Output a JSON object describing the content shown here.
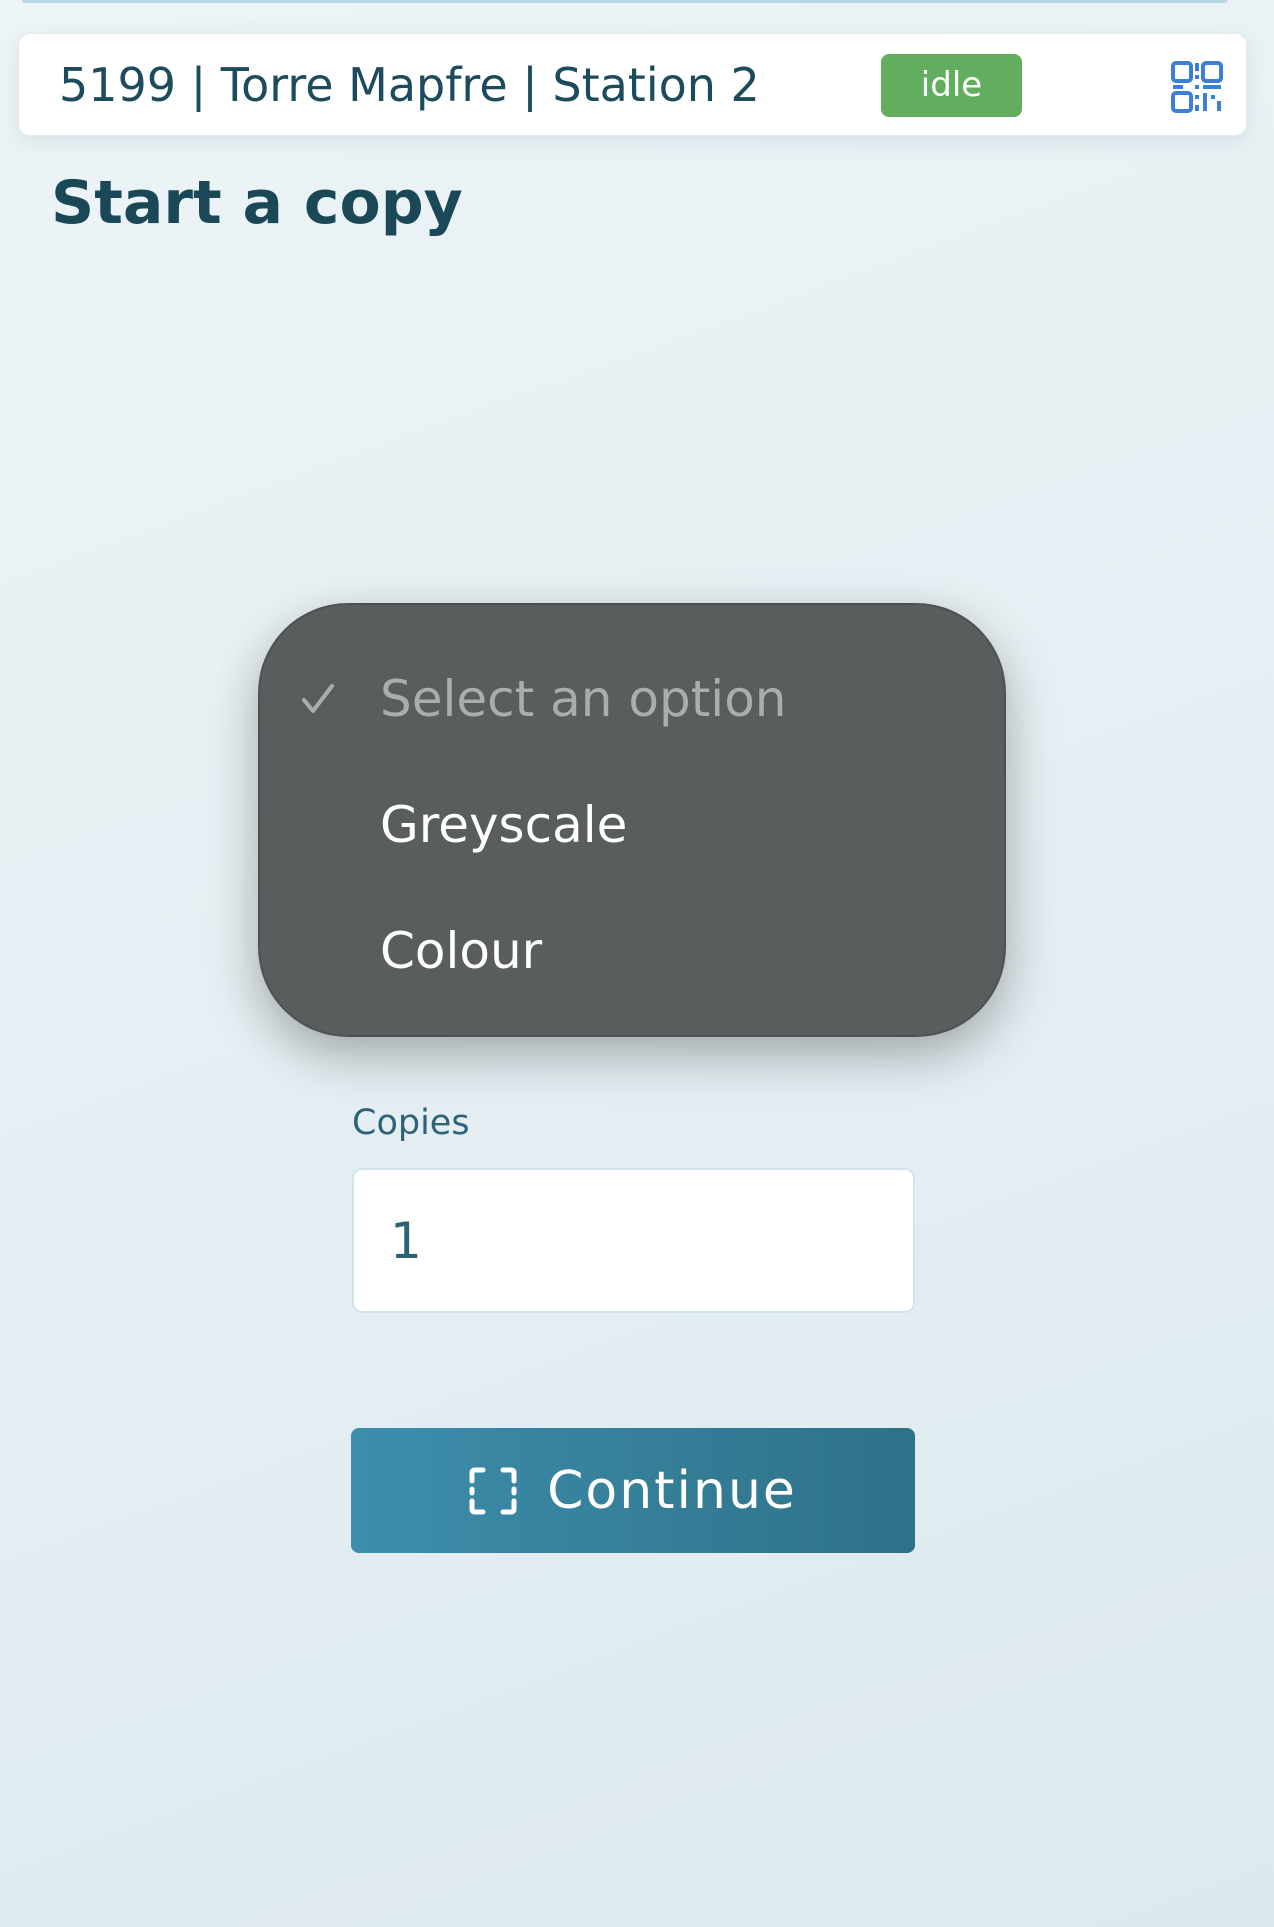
{
  "station": {
    "name": "5199 | Torre Mapfre | Station 2",
    "status": "idle",
    "qr_icon": "qr-code-icon",
    "status_color": "#62ae5e",
    "qr_color": "#3b7fd8"
  },
  "page": {
    "title": "Start a copy"
  },
  "form": {
    "copies_label": "Copies",
    "copies_value": "1",
    "continue_label": "Continue",
    "continue_icon": "scan-frame-icon",
    "button_color": "#3d8eac"
  },
  "dropdown": {
    "options": [
      {
        "label": "Select an option",
        "selected": true,
        "placeholder": true
      },
      {
        "label": "Greyscale",
        "selected": false,
        "placeholder": false
      },
      {
        "label": "Colour",
        "selected": false,
        "placeholder": false
      }
    ],
    "check_icon": "checkmark-icon",
    "popup_color": "#545858"
  }
}
